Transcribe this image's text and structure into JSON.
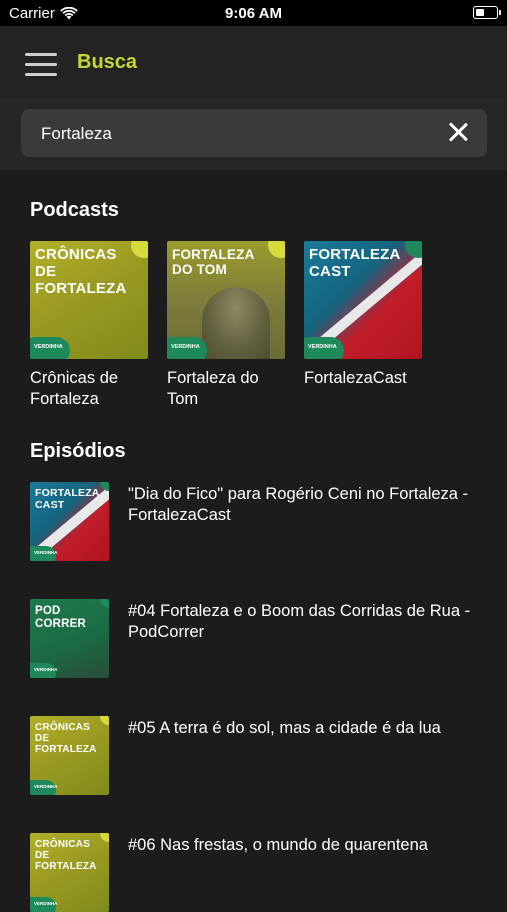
{
  "status_bar": {
    "carrier": "Carrier",
    "time": "9:06 AM",
    "battery_level": 0.45
  },
  "nav": {
    "title": "Busca",
    "menu_icon": "hamburger-menu-icon"
  },
  "search": {
    "value": "Fortaleza",
    "clear_icon": "close-icon"
  },
  "podcasts": {
    "heading": "Podcasts",
    "items": [
      {
        "name": "Crônicas de Fortaleza",
        "cover_text": "CRÔNICAS DE FORTALEZA",
        "brand": "VERDINHA"
      },
      {
        "name": "Fortaleza do Tom",
        "cover_text": "FORTALEZA DO TOM",
        "brand": "VERDINHA"
      },
      {
        "name": "FortalezaCast",
        "cover_text": "FORTALEZA CAST",
        "brand": "VERDINHA"
      }
    ]
  },
  "episodes": {
    "heading": "Episódios",
    "items": [
      {
        "title": "\"Dia do Fico\" para Rogério Ceni no Fortaleza - FortalezaCast",
        "cover_text": "FORTALEZA CAST",
        "brand": "VERDINHA"
      },
      {
        "title": "#04 Fortaleza e o Boom das Corridas de Rua - PodCorrer",
        "cover_text": "POD CORRER",
        "brand": "VERDINHA"
      },
      {
        "title": "#05 A terra é do sol, mas a cidade é da lua",
        "cover_text": "CRÔNICAS DE FORTALEZA",
        "brand": "VERDINHA"
      },
      {
        "title": "#06 Nas frestas, o mundo de quarentena",
        "cover_text": "CRÔNICAS DE FORTALEZA",
        "brand": "VERDINHA"
      }
    ]
  },
  "colors": {
    "accent": "#c8d633",
    "background": "#1c1c1c",
    "nav_background": "#232323",
    "search_field": "#3a3a3a"
  }
}
